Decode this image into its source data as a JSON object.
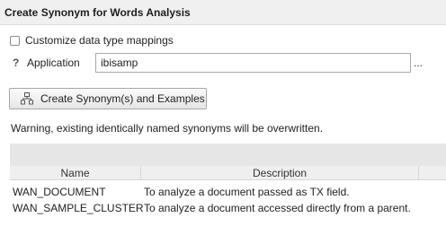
{
  "panel": {
    "title": "Create Synonym for Words Analysis"
  },
  "options": {
    "customize_label": "Customize data type mappings",
    "customize_checked": false
  },
  "application": {
    "help_glyph": "?",
    "label": "Application",
    "value": "ibisamp",
    "browse_label": "..."
  },
  "create_button": {
    "label": "Create Synonym(s) and Examples",
    "icon": "hierarchy-icon"
  },
  "warning": "Warning, existing identically named synonyms will be overwritten.",
  "table": {
    "columns": [
      "Name",
      "Description"
    ],
    "rows": [
      {
        "name": "WAN_DOCUMENT",
        "description": "To analyze a document passed as TX field."
      },
      {
        "name": "WAN_SAMPLE_CLUSTER",
        "description": "To analyze a document accessed directly from a parent."
      }
    ]
  }
}
